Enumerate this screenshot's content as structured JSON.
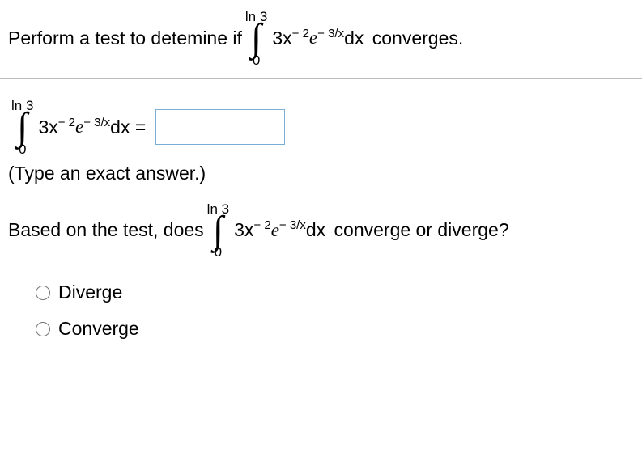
{
  "top": {
    "prefix": "Perform a test to detemine if",
    "suffix": "converges."
  },
  "integral": {
    "upper1": "ln",
    "upper2": "3",
    "lower": "0",
    "coef": "3x",
    "exp1": "− 2",
    "e": "e",
    "exp2": "− 3/x",
    "dx": "dx"
  },
  "middle": {
    "equals": "=",
    "hint": "(Type an exact answer.)"
  },
  "q2": {
    "prefix": "Based on the test, does",
    "suffix": "converge or diverge?"
  },
  "options": {
    "a": "Diverge",
    "b": "Converge"
  }
}
